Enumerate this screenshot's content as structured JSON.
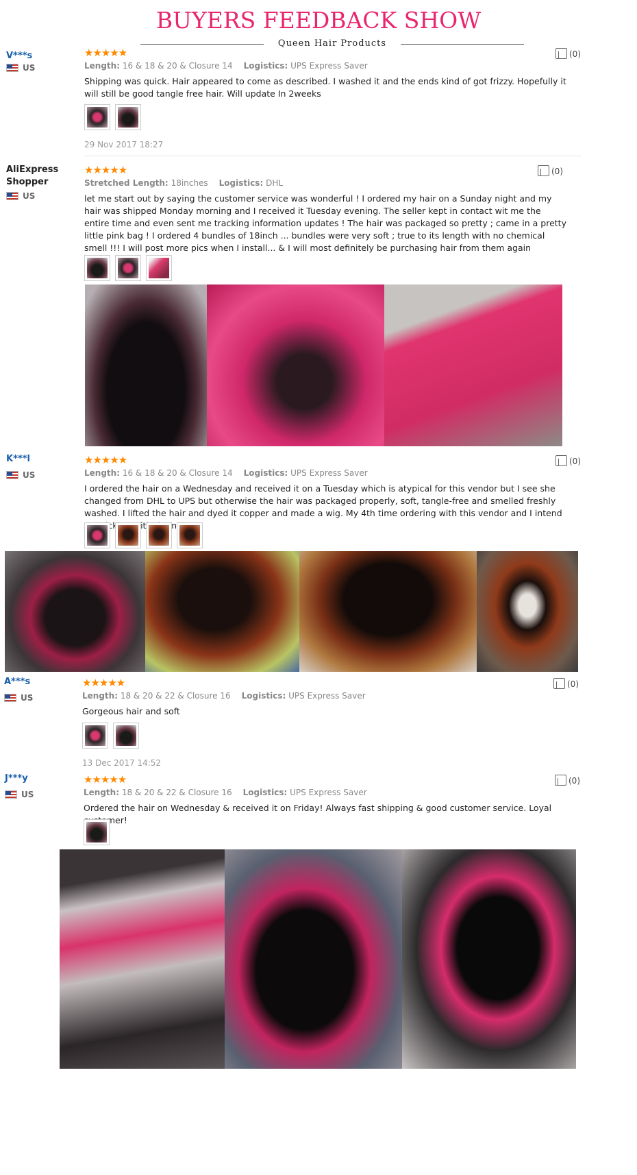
{
  "header": {
    "title": "BUYERS FEEDBACK SHOW",
    "subtitle": "Queen Hair Products"
  },
  "labels": {
    "length": "Length:",
    "stretched_length": "Stretched Length:",
    "logistics": "Logistics:"
  },
  "stars": "★★★★★",
  "reviews": [
    {
      "name": "V***s",
      "country": "US",
      "length": "16 & 18 & 20 & Closure 14",
      "logistics": "UPS Express Saver",
      "text": "Shipping was quick. Hair appeared to come as described. I washed it and the ends kind of got frizzy. Hopefully it will still be good tangle free hair. Will update In 2weeks",
      "date": "29 Nov 2017 18:27",
      "likes": "(0)"
    },
    {
      "name": "AliExpress Shopper",
      "country": "US",
      "length": "18inches",
      "logistics": "DHL",
      "text": "let me start out by saying the customer service was wonderful ! I ordered my hair on a Sunday night and my hair was shipped Monday morning and I received it Tuesday evening. The seller kept in contact wit me the entire time and even sent me tracking information updates ! The hair was packaged so pretty ; came in a pretty little pink bag ! I ordered 4 bundles of 18inch ... bundles were very soft ; true to its length with no chemical smell !!! I will post more pics when I install... & I will most definitely be purchasing hair from them again",
      "likes": "(0)"
    },
    {
      "name": "K***l",
      "country": "US",
      "length": "16 & 18 & 20 & Closure 14",
      "logistics": "UPS Express Saver",
      "text": "I ordered the hair on a Wednesday and received it on a Tuesday which is atypical for this vendor but I see she changed from DHL to UPS but otherwise the hair was packaged properly, soft, tangle-free and smelled freshly washed. I lifted the hair and dyed it copper and made a wig. My 4th time ordering with this vendor and I intend on sticking with them!!!",
      "likes": "(0)"
    },
    {
      "name": "A***s",
      "country": "US",
      "length": "18 & 20 & 22 & Closure 16",
      "logistics": "UPS Express Saver",
      "text": "Gorgeous hair and soft",
      "date": "13 Dec 2017 14:52",
      "likes": "(0)"
    },
    {
      "name": "J***y",
      "country": "US",
      "length": "18 & 20 & 22 & Closure 16",
      "logistics": "UPS Express Saver",
      "text": "Ordered the hair on Wednesday & received it on Friday! Always fast shipping & good customer service. Loyal customer!",
      "likes": "(0)"
    }
  ]
}
